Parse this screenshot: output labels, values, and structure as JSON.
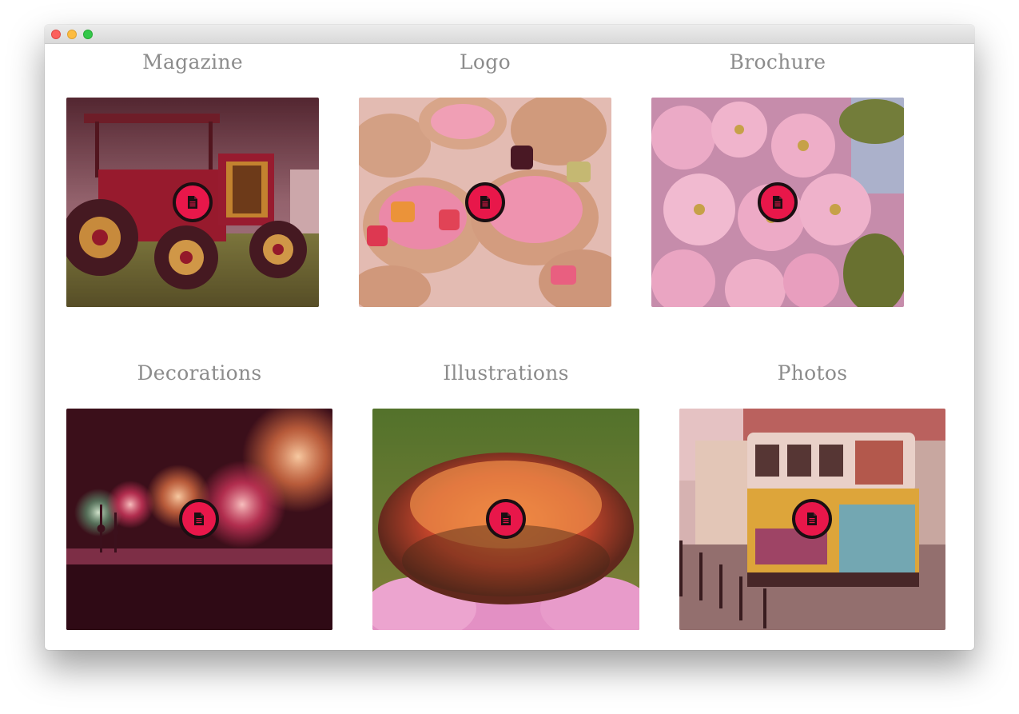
{
  "window": {
    "controls": [
      "close",
      "minimize",
      "maximize"
    ]
  },
  "portfolio": {
    "items": [
      {
        "title": "Magazine",
        "icon": "document-icon"
      },
      {
        "title": "Logo",
        "icon": "document-icon"
      },
      {
        "title": "Brochure",
        "icon": "document-icon"
      },
      {
        "title": "Decorations",
        "icon": "document-icon"
      },
      {
        "title": "Illustrations",
        "icon": "document-icon"
      },
      {
        "title": "Photos",
        "icon": "document-icon"
      }
    ]
  },
  "colors": {
    "badge": "#e8174a",
    "badge_ring": "#1a0f12",
    "caption": "#8c8c8c"
  }
}
